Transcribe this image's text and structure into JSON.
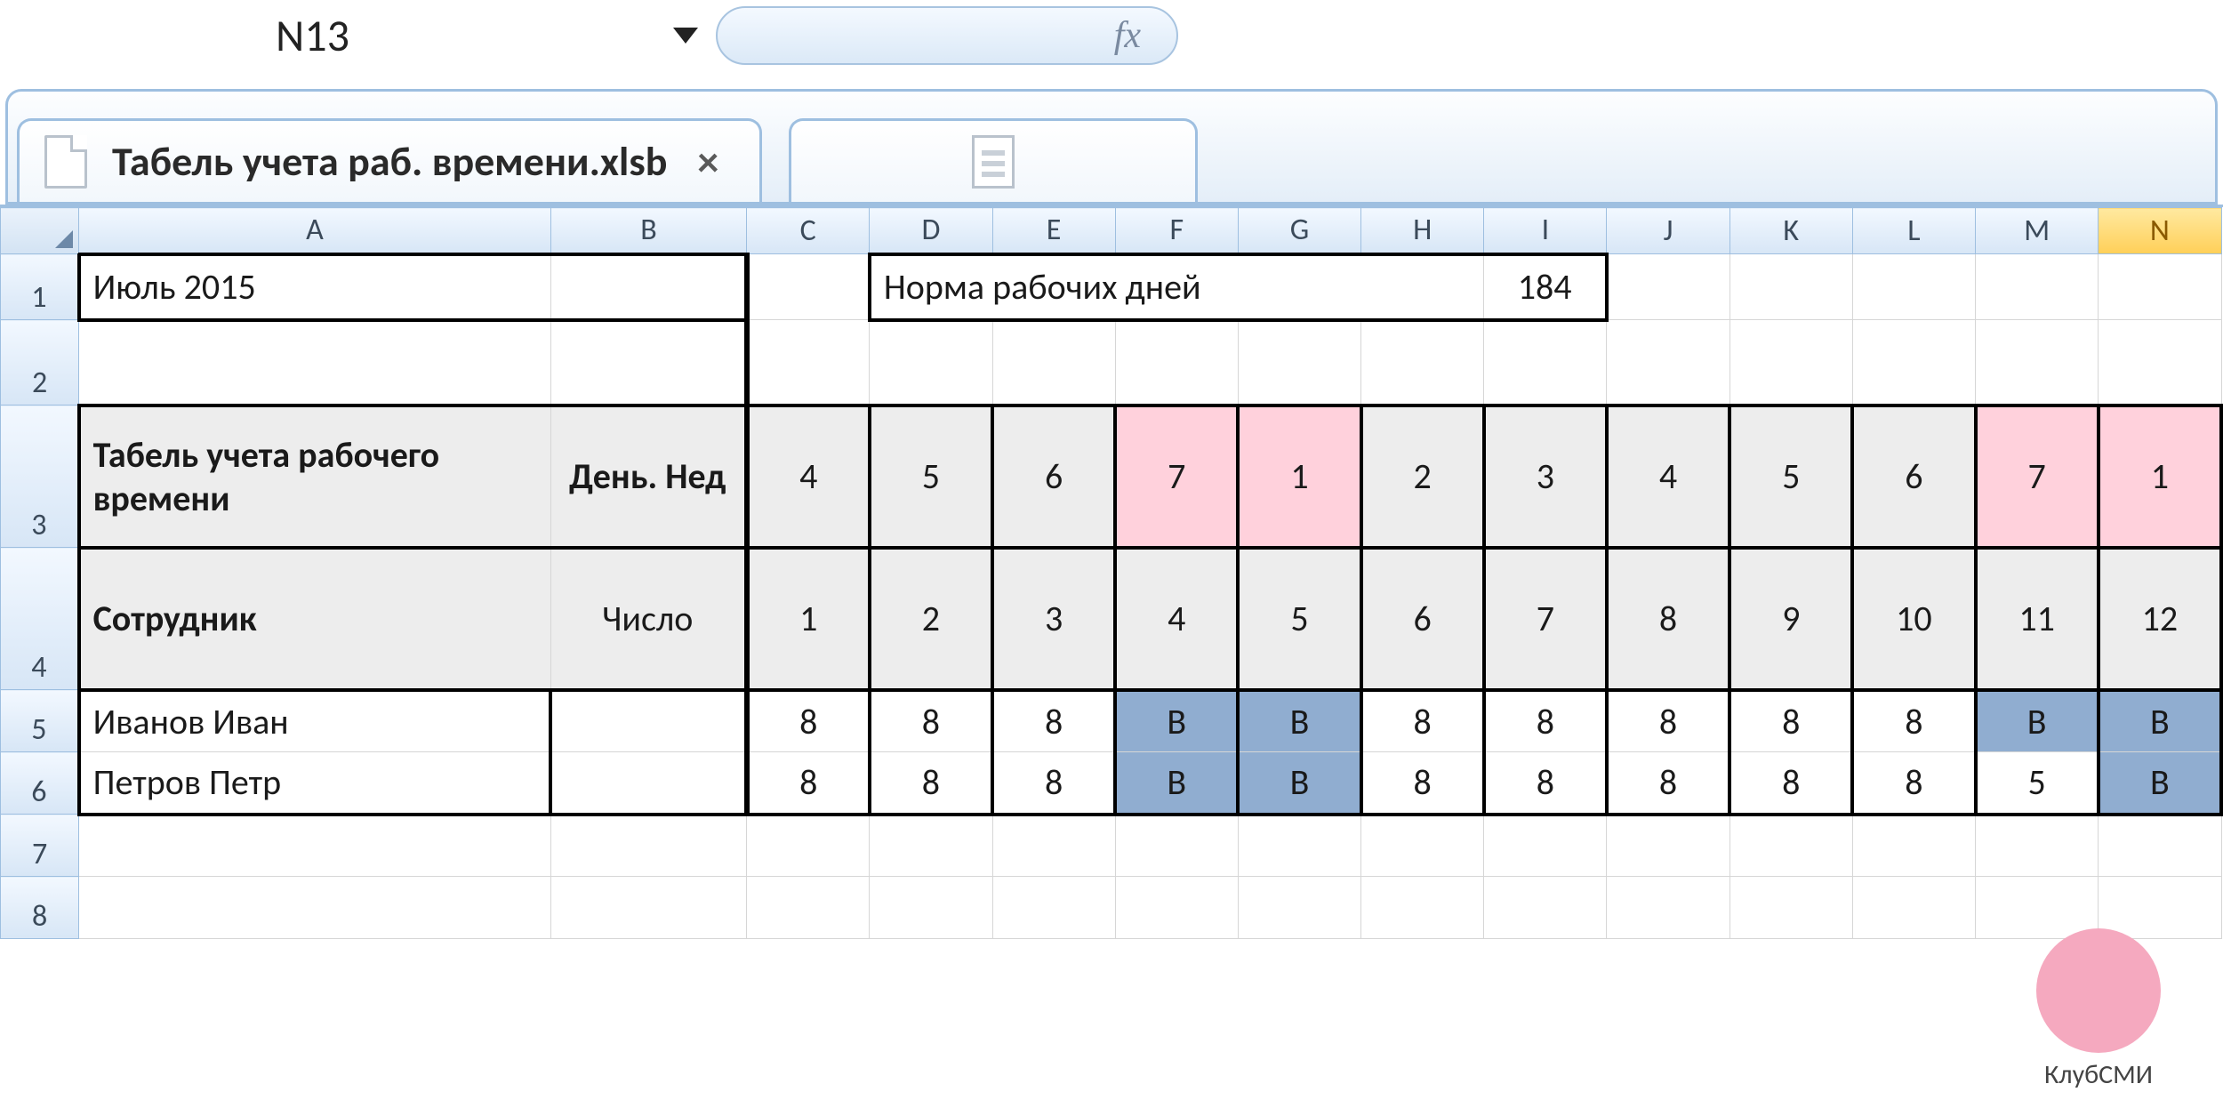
{
  "formula_bar": {
    "cell_ref": "N13",
    "fx_label": "fx",
    "formula_value": ""
  },
  "tabs": {
    "active": "Табель учета раб. времени.xlsb"
  },
  "columns": [
    "A",
    "B",
    "C",
    "D",
    "E",
    "F",
    "G",
    "H",
    "I",
    "J",
    "K",
    "L",
    "M",
    "N"
  ],
  "selected_column": "N",
  "row_numbers": [
    1,
    2,
    3,
    4,
    5,
    6,
    7,
    8
  ],
  "sheet": {
    "period": "Июль 2015",
    "norm_label": "Норма рабочих дней",
    "norm_value": "184",
    "header_title": "Табель учета рабочего времени",
    "dow_label": "День. Нед",
    "employee_label": "Сотрудник",
    "date_label": "Число",
    "dow": [
      "4",
      "5",
      "6",
      "7",
      "1",
      "2",
      "3",
      "4",
      "5",
      "6",
      "7",
      "1"
    ],
    "dates": [
      "1",
      "2",
      "3",
      "4",
      "5",
      "6",
      "7",
      "8",
      "9",
      "10",
      "11",
      "12"
    ],
    "weekend_idx": [
      3,
      4,
      10,
      11
    ],
    "rows": [
      {
        "name": "Иванов Иван",
        "vals": [
          "8",
          "8",
          "8",
          "B",
          "B",
          "8",
          "8",
          "8",
          "8",
          "8",
          "B",
          "B"
        ],
        "blue_idx": [
          3,
          4,
          10,
          11
        ]
      },
      {
        "name": "Петров Петр",
        "vals": [
          "8",
          "8",
          "8",
          "B",
          "B",
          "8",
          "8",
          "8",
          "8",
          "8",
          "5",
          "B"
        ],
        "blue_idx": [
          3,
          4,
          11
        ]
      }
    ]
  },
  "watermark": "КлубСМИ"
}
